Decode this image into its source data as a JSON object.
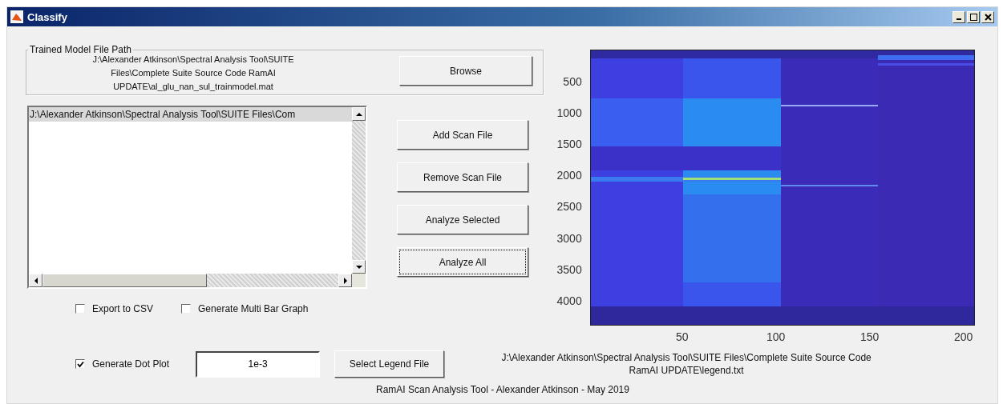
{
  "window": {
    "title": "Classify"
  },
  "model_path": {
    "label": "Trained Model File Path",
    "path_lines": [
      "J:\\Alexander Atkinson\\Spectral Analysis Tool\\SUITE",
      "Files\\Complete Suite Source Code RamAI",
      "UPDATE\\al_glu_nan_sul_trainmodel.mat"
    ],
    "browse_button": "Browse"
  },
  "scan_files": [
    {
      "text": "J:\\Alexander Atkinson\\Spectral Analysis Tool\\SUITE Files\\Com",
      "selected": true
    }
  ],
  "buttons": [
    {
      "label": "Add Scan File",
      "focused": false
    },
    {
      "label": "Remove Scan File",
      "focused": false
    },
    {
      "label": "Analyze Selected",
      "focused": false
    },
    {
      "label": "Analyze All",
      "focused": true
    }
  ],
  "options": [
    {
      "label": "Export to CSV",
      "checked": false
    },
    {
      "label": "Generate Multi Bar Graph",
      "checked": false
    }
  ],
  "dot_plot": {
    "label": "Generate Dot Plot",
    "checked": true,
    "threshold": "1e-3",
    "legend_button": "Select Legend File",
    "legend_path_lines": [
      "J:\\Alexander Atkinson\\Spectral Analysis Tool\\SUITE Files\\Complete Suite Source Code",
      "RamAI UPDATE\\legend.txt"
    ]
  },
  "plot": {
    "y_ticks": [
      "500",
      "1000",
      "1500",
      "2000",
      "2500",
      "3000",
      "3500",
      "4000"
    ],
    "x_ticks": [
      "50",
      "100",
      "150",
      "200"
    ]
  },
  "footer": "RamAI Scan Analysis Tool - Alexander Atkinson - May 2019"
}
